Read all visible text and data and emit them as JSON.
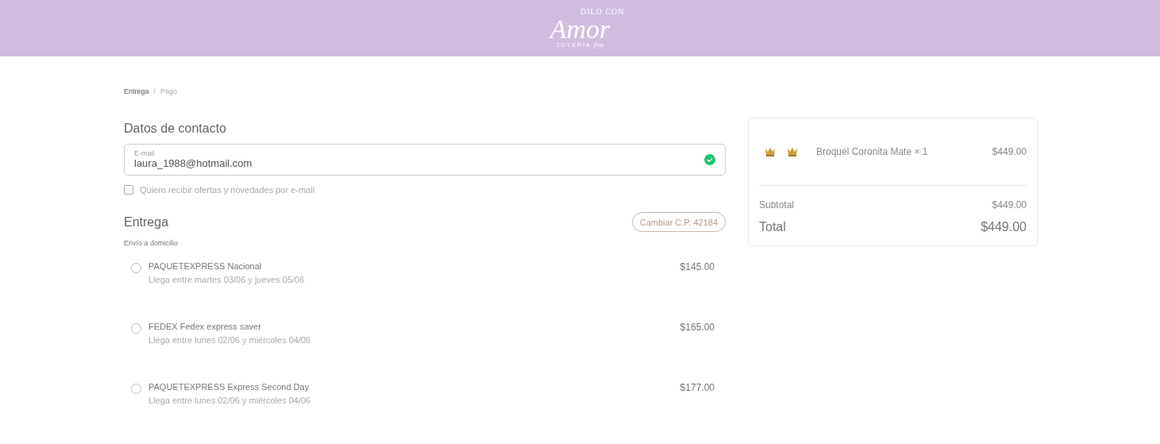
{
  "header": {
    "logo": {
      "top": "DILO CON",
      "main": "Amor",
      "sub": "JOYERIA",
      "tagline": "fina"
    }
  },
  "breadcrumb": {
    "separator": "/",
    "steps": [
      {
        "label": "Entrega",
        "selected": true
      },
      {
        "label": "Pago",
        "selected": false
      }
    ]
  },
  "contact": {
    "title": "Datos de contacto",
    "email": {
      "label": "E-mail",
      "value": "laura_1988@hotmail.com",
      "valid": true
    },
    "newsletter": {
      "label": "Quiero recibir ofertas y novedades por e-mail",
      "checked": false
    }
  },
  "delivery": {
    "title": "Entrega",
    "change_button": "Cambiar C.P. 42184",
    "method": "Envío a domicilio",
    "options": [
      {
        "name": "PAQUETEXPRESS Nacional",
        "eta": "Llega entre martes 03/06 y jueves 05/06",
        "price": "$145.00",
        "selected": false
      },
      {
        "name": "FEDEX Fedex express saver",
        "eta": "Llega entre lunes 02/06 y miércoles 04/06",
        "price": "$165.00",
        "selected": false
      },
      {
        "name": "PAQUETEXPRESS Express Second Day",
        "eta": "Llega entre lunes 02/06 y miércoles 04/06",
        "price": "$177.00",
        "selected": false
      }
    ]
  },
  "summary": {
    "items": [
      {
        "name": "Broquel Coronita Mate × 1",
        "price": "$449.00"
      }
    ],
    "subtotal_label": "Subtotal",
    "subtotal": "$449.00",
    "total_label": "Total",
    "total": "$449.00"
  }
}
